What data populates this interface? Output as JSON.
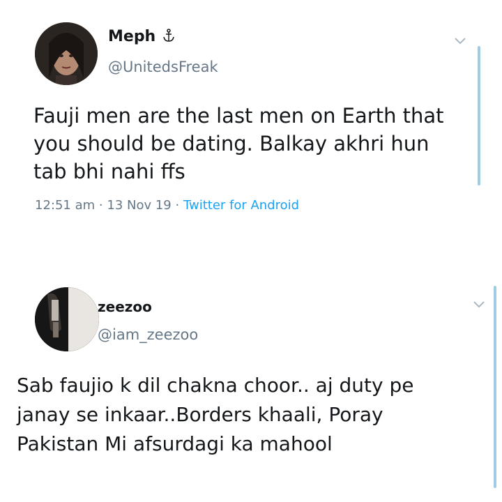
{
  "tweets": [
    {
      "display_name": "Meph",
      "name_badge_icon": "anchor-icon",
      "handle": "@UnitedsFreak",
      "text_lines": [
        "Fauji men are the last men on Earth that",
        "you should be dating. Balkay akhri hun",
        "tab bhi nahi ffs"
      ],
      "time": "12:51 am",
      "date": "13 Nov 19",
      "separator": "·",
      "client": "Twitter for Android"
    },
    {
      "display_name": "zeezoo",
      "handle": "@iam_zeezoo",
      "text_lines": [
        "Sab faujio k dil chakna choor.. aj duty pe",
        "janay se inkaar..Borders khaali, Poray",
        "Pakistan Mi afsurdagi ka mahool"
      ]
    }
  ],
  "colors": {
    "text": "#14171a",
    "secondary": "#657786",
    "link": "#1da1f2",
    "scrollbar": "#9fcbe6"
  }
}
